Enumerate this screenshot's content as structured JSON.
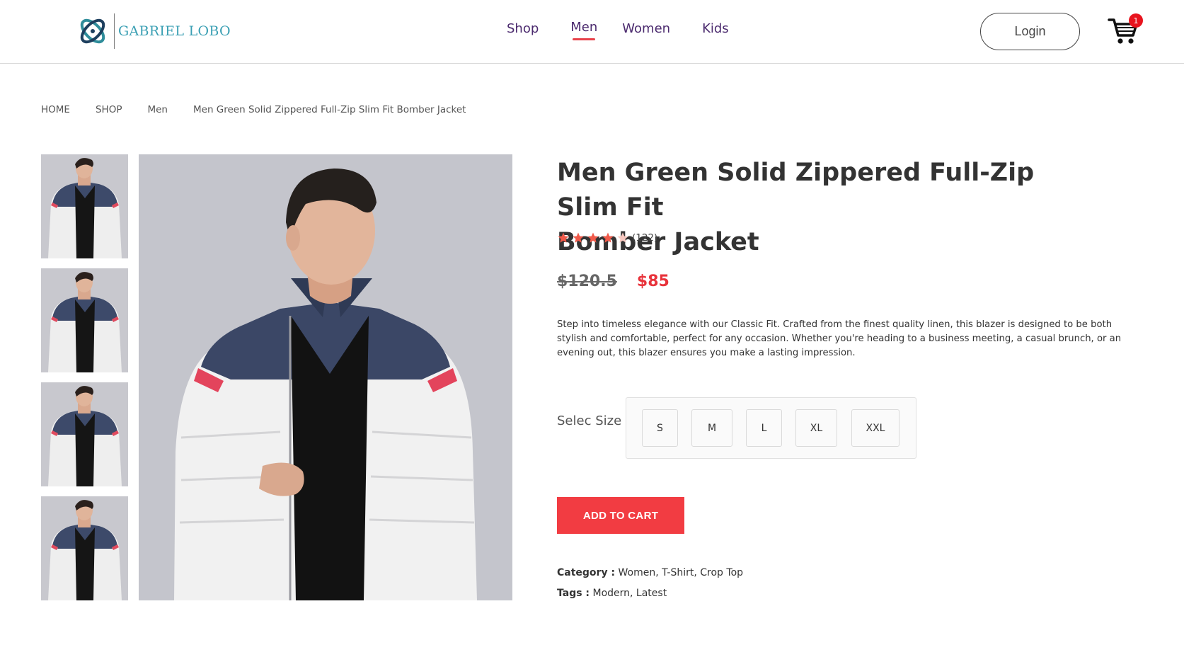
{
  "brand": {
    "name": "GABRIEL LOBO"
  },
  "nav": {
    "shop": "Shop",
    "men": "Men",
    "women": "Women",
    "kids": "Kids"
  },
  "header": {
    "login_label": "Login",
    "cart_count": "1"
  },
  "breadcrumb": {
    "home": "HOME",
    "shop": "SHOP",
    "category": "Men",
    "current": "Men Green Solid Zippered Full-Zip Slim Fit Bomber Jacket"
  },
  "product": {
    "title_line1": "Men Green Solid Zippered Full-Zip Slim Fit",
    "title_line2": "Bomber Jacket",
    "rating_stars": 4,
    "rating_max": 5,
    "rating_count": "(122)",
    "old_price": "$120.5",
    "price": "$85",
    "description": "Step into timeless elegance with our Classic Fit. Crafted from the finest quality linen, this blazer is designed to be both stylish and comfortable, perfect for any occasion. Whether you're heading to a business meeting, a casual brunch, or an evening out, this blazer ensures you make a lasting impression.",
    "size_label": "Selec Size",
    "sizes": [
      "S",
      "M",
      "L",
      "XL",
      "XXL"
    ],
    "add_to_cart_label": "ADD TO CART",
    "category_label": "Category :",
    "categories": [
      "Women",
      "T-Shirt",
      "Crop Top"
    ],
    "tags_label": "Tags :",
    "tags": [
      "Modern",
      "Latest"
    ]
  },
  "colors": {
    "accent": "#f23c42",
    "nav": "#4b2a6e",
    "brand": "#3a9fb3",
    "star": "#f05a4a"
  },
  "icons": {
    "cart": "cart-icon",
    "logo": "logo-icon",
    "star": "star-icon"
  }
}
